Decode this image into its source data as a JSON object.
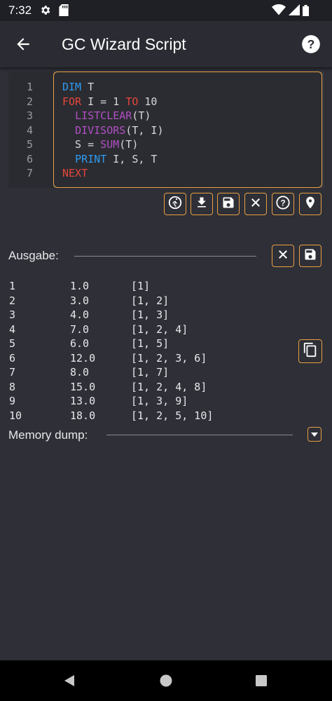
{
  "status": {
    "time": "7:32"
  },
  "appbar": {
    "title": "GC Wizard Script"
  },
  "editor": {
    "line_numbers": [
      "1",
      "2",
      "3",
      "4",
      "5",
      "6",
      "7"
    ],
    "lines": [
      [
        {
          "t": "DIM",
          "c": "kw-blue"
        },
        {
          "t": " T",
          "c": "plain"
        }
      ],
      [
        {
          "t": "FOR",
          "c": "kw-red"
        },
        {
          "t": " I = 1 ",
          "c": "plain"
        },
        {
          "t": "TO",
          "c": "kw-red"
        },
        {
          "t": " 10",
          "c": "plain"
        }
      ],
      [
        {
          "t": "  ",
          "c": "plain"
        },
        {
          "t": "LISTCLEAR",
          "c": "kw-purple"
        },
        {
          "t": "(T)",
          "c": "plain"
        }
      ],
      [
        {
          "t": "  ",
          "c": "plain"
        },
        {
          "t": "DIVISORS",
          "c": "kw-purple"
        },
        {
          "t": "(T, I)",
          "c": "plain"
        }
      ],
      [
        {
          "t": "  S = ",
          "c": "plain"
        },
        {
          "t": "SUM",
          "c": "kw-purple"
        },
        {
          "t": "(T)",
          "c": "plain"
        }
      ],
      [
        {
          "t": "  ",
          "c": "plain"
        },
        {
          "t": "PRINT",
          "c": "kw-blue"
        },
        {
          "t": " I, S, T",
          "c": "plain"
        }
      ],
      [
        {
          "t": "NEXT",
          "c": "kw-red"
        }
      ]
    ]
  },
  "toolbar": {
    "buttons": [
      "run-icon",
      "download-icon",
      "save-icon",
      "clear-icon",
      "help-circle-icon",
      "location-pin-icon"
    ]
  },
  "output": {
    "label": "Ausgabe:",
    "rows": [
      [
        "1",
        "1.0",
        "[1]"
      ],
      [
        "2",
        "3.0",
        "[1, 2]"
      ],
      [
        "3",
        "4.0",
        "[1, 3]"
      ],
      [
        "4",
        "7.0",
        "[1, 2, 4]"
      ],
      [
        "5",
        "6.0",
        "[1, 5]"
      ],
      [
        "6",
        "12.0",
        "[1, 2, 3, 6]"
      ],
      [
        "7",
        "8.0",
        "[1, 7]"
      ],
      [
        "8",
        "15.0",
        "[1, 2, 4, 8]"
      ],
      [
        "9",
        "13.0",
        "[1, 3, 9]"
      ],
      [
        "10",
        "18.0",
        "[1, 2, 5, 10]"
      ]
    ]
  },
  "memory": {
    "label": "Memory dump:"
  },
  "colors": {
    "accent": "#e8a043",
    "background": "#2e2f37"
  }
}
